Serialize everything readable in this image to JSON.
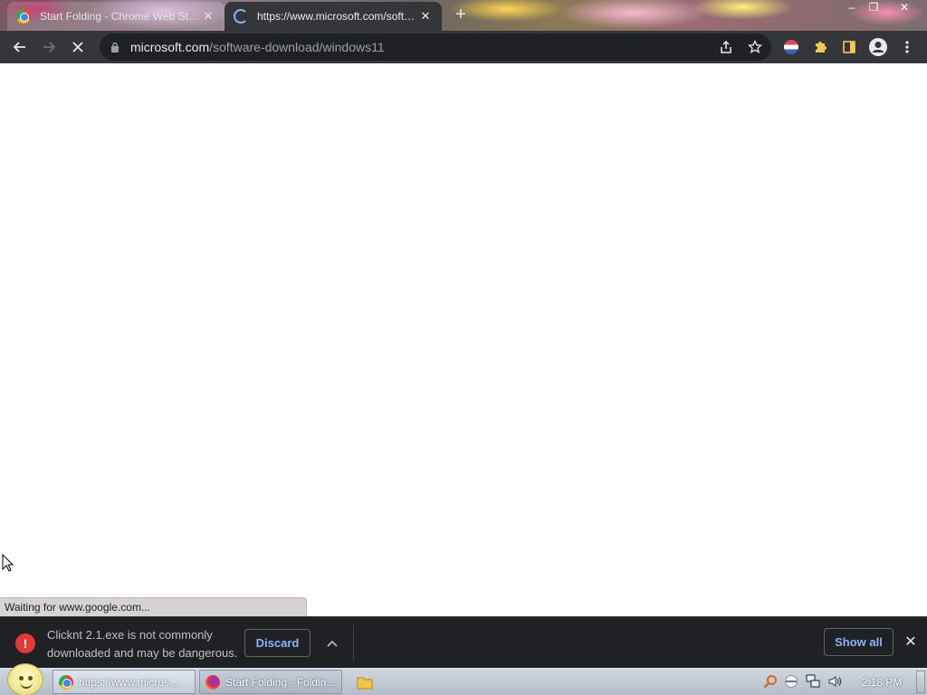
{
  "browser": {
    "tabs": [
      {
        "title": "Start Folding - Chrome Web Store",
        "active": false,
        "favicon": "chrome-icon"
      },
      {
        "title": "https://www.microsoft.com/software-download/windows11",
        "active": true,
        "favicon": "loading-spinner-icon"
      }
    ],
    "new_tab_label": "+",
    "window_controls": {
      "minimize": "–",
      "restore": "❐",
      "close": "✕"
    },
    "address": {
      "host": "microsoft.com",
      "path": "/software-download/windows11"
    },
    "status_text": "Waiting for www.google.com..."
  },
  "download_bar": {
    "file_warning_line1": "Clicknt 2.1.exe is not commonly",
    "file_warning_line2": "downloaded and may be dangerous.",
    "discard_label": "Discard",
    "show_all_label": "Show all",
    "colors": {
      "warning": "#e53935",
      "link": "#8ab4f8"
    }
  },
  "taskbar": {
    "items": [
      {
        "label": "https://www.micros...",
        "icon": "chrome-icon",
        "active": true
      },
      {
        "label": "Start Folding - Foldin...",
        "icon": "firefox-icon",
        "active": false
      }
    ],
    "time": "2:18 PM"
  }
}
